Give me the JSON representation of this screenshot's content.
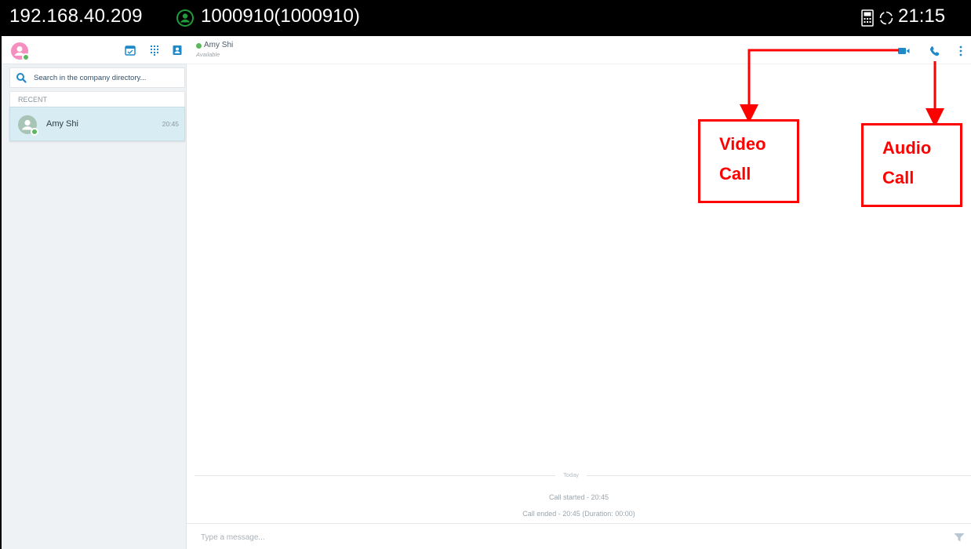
{
  "status_bar": {
    "ip": "192.168.40.209",
    "account": "1000910(1000910)",
    "time": "21:15"
  },
  "sidebar": {
    "search_placeholder": "Search in the company directory...",
    "recent_label": "RECENT",
    "contacts": [
      {
        "name": "Amy Shi",
        "time": "20:45",
        "presence": "available"
      }
    ]
  },
  "chat": {
    "contact_name": "Amy Shi",
    "contact_status": "Available",
    "date_separator": "Today",
    "system_messages": [
      "Call started - 20:45",
      "Call ended - 20:45 (Duration: 00:00)"
    ],
    "composer_placeholder": "Type a message..."
  },
  "annotations": {
    "video_call": [
      "Video",
      "Call"
    ],
    "audio_call": [
      "Audio",
      "Call"
    ]
  },
  "colors": {
    "accent": "#1e88c8",
    "presence_available": "#5cb85c",
    "annotation": "#ff0000"
  }
}
